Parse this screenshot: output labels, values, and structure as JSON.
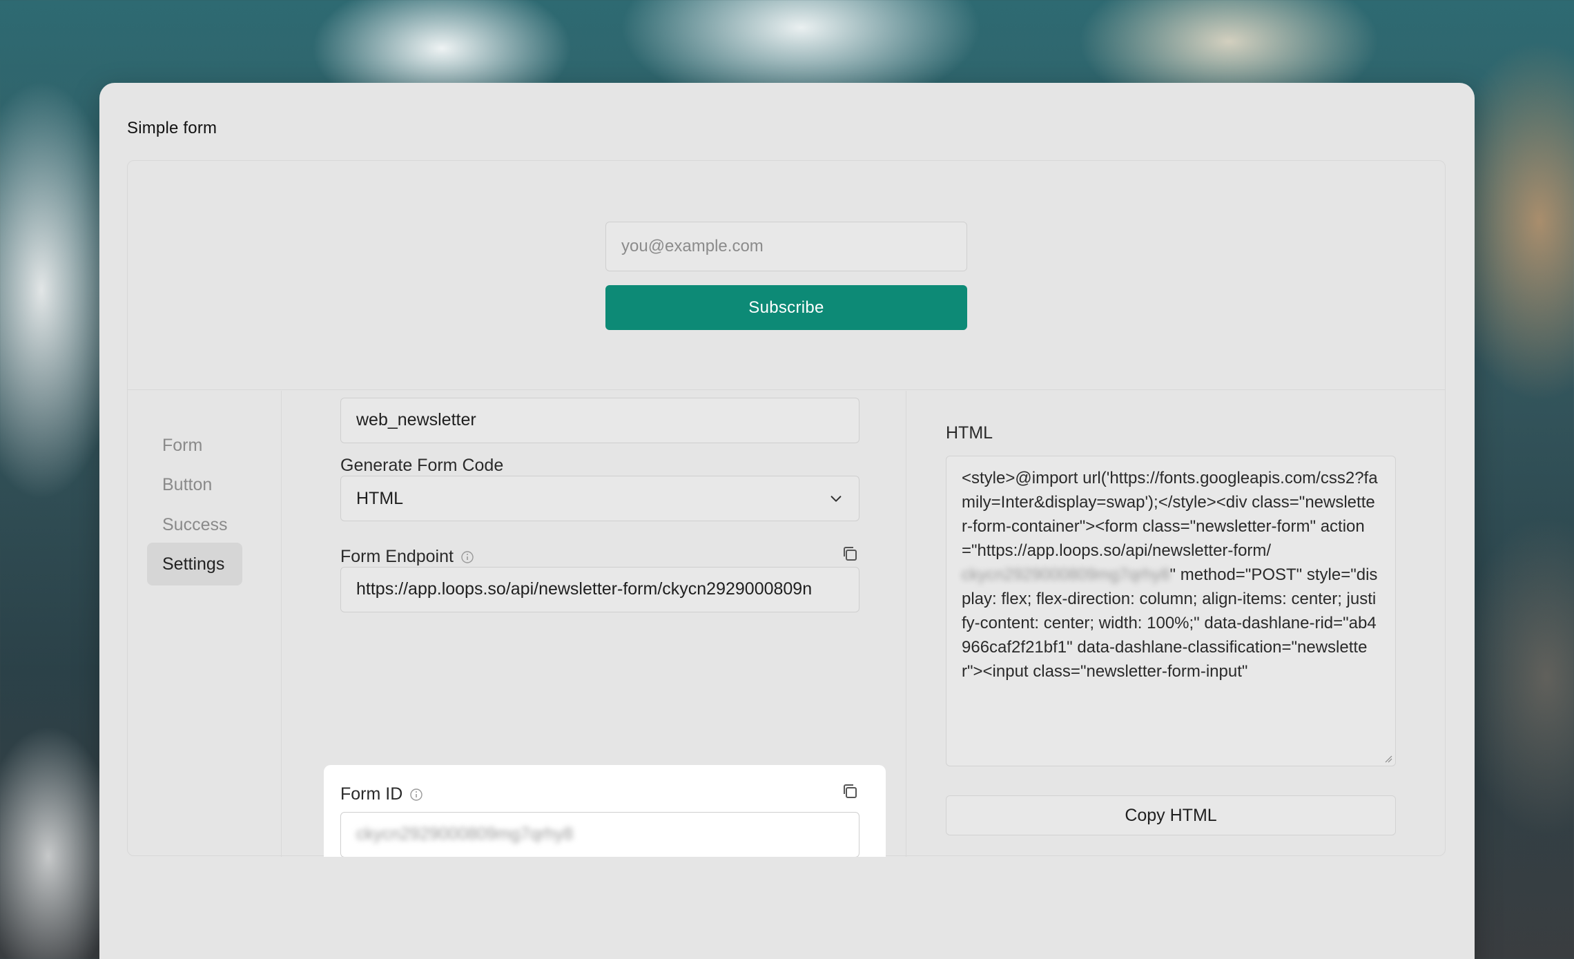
{
  "window": {
    "title": "Simple form"
  },
  "preview": {
    "email_placeholder": "you@example.com",
    "subscribe_label": "Subscribe",
    "button_color": "#0d8a76"
  },
  "sidebar": {
    "items": [
      {
        "label": "Form",
        "active": false
      },
      {
        "label": "Button",
        "active": false
      },
      {
        "label": "Success",
        "active": false
      },
      {
        "label": "Settings",
        "active": true
      }
    ]
  },
  "settings": {
    "source_value": "web_newsletter",
    "generate_label": "Generate Form Code",
    "generate_value": "HTML",
    "endpoint_label": "Form Endpoint",
    "endpoint_value": "https://app.loops.so/api/newsletter-form/ckycn2929000809n",
    "form_id_label": "Form ID",
    "form_id_value": "ckycn2929000809mg7qrhy8"
  },
  "code": {
    "label": "HTML",
    "text_before": "<style>@import url('https://fonts.googleapis.com/css2?family=Inter&display=swap');</style><div class=\"newsletter-form-container\"><form class=\"newsletter-form\" action=\"https://app.loops.so/api/newsletter-form/",
    "text_blurred": "ckycn2929000809mg7qrhy8",
    "text_after": "\" method=\"POST\" style=\"display: flex; flex-direction: column; align-items: center; justify-content: center; width: 100%;\" data-dashlane-rid=\"ab4966caf2f21bf1\" data-dashlane-classification=\"newsletter\"><input class=\"newsletter-form-input\"",
    "copy_label": "Copy HTML"
  }
}
